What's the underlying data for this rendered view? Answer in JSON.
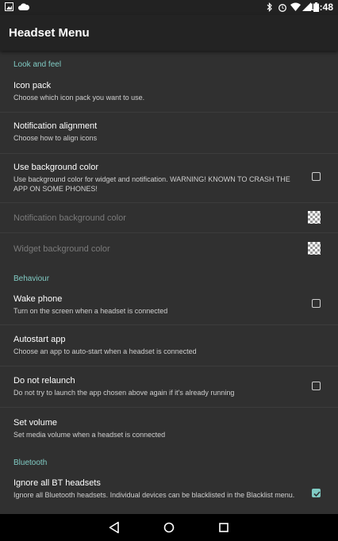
{
  "status": {
    "time": "15:48"
  },
  "app": {
    "title": "Headset Menu"
  },
  "sections": {
    "look": "Look and feel",
    "behaviour": "Behaviour",
    "bluetooth": "Bluetooth"
  },
  "prefs": {
    "icon_pack": {
      "title": "Icon pack",
      "summary": "Choose which icon pack you want to use."
    },
    "notif_align": {
      "title": "Notification alignment",
      "summary": "Choose how to align icons"
    },
    "use_bg": {
      "title": "Use background color",
      "summary": "Use background color for widget and notification. WARNING! KNOWN TO CRASH THE APP ON SOME PHONES!",
      "checked": false
    },
    "notif_bg": {
      "title": "Notification background color"
    },
    "widget_bg": {
      "title": "Widget background color"
    },
    "wake": {
      "title": "Wake phone",
      "summary": "Turn on the screen when a headset is connected",
      "checked": false
    },
    "autostart": {
      "title": "Autostart app",
      "summary": "Choose an app to auto-start when a headset is connected"
    },
    "relaunch": {
      "title": "Do not relaunch",
      "summary": "Do not try to launch the app chosen above again if it's already running",
      "checked": false
    },
    "volume": {
      "title": "Set volume",
      "summary": "Set media volume when a headset is connected"
    },
    "ignore_bt": {
      "title": "Ignore all BT headsets",
      "summary": "Ignore all Bluetooth headsets. Individual devices can be blacklisted in the Blacklist menu.",
      "checked": true
    }
  },
  "colors": {
    "accent": "#80cbc4",
    "background": "#303030",
    "appbar": "#232323"
  },
  "icons": [
    "image-icon",
    "cloud-icon",
    "bluetooth-icon",
    "alarm-icon",
    "wifi-icon",
    "signal-icon",
    "battery-icon",
    "back-icon",
    "home-icon",
    "recents-icon"
  ]
}
